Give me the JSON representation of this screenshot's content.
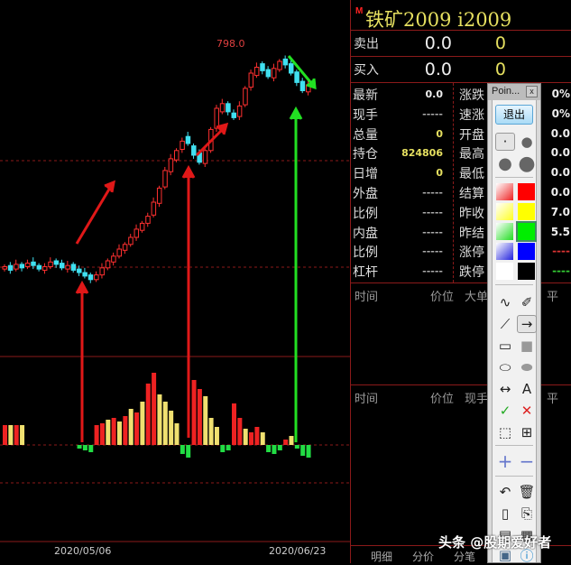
{
  "chart_data": {
    "type": "candlestick",
    "annotations": {
      "high_label": "798.0"
    },
    "x_labels": [
      "2020/05/06",
      "2020/06/23"
    ],
    "candles": {
      "close": [
        613,
        610,
        615,
        612,
        616,
        614,
        611,
        613,
        617,
        615,
        612,
        614,
        610,
        608,
        605,
        602,
        606,
        612,
        618,
        622,
        628,
        632,
        638,
        645,
        650,
        656,
        668,
        680,
        695,
        705,
        712,
        720,
        718,
        708,
        702,
        712,
        730,
        748,
        752,
        745,
        740,
        750,
        765,
        778,
        783,
        780,
        775,
        782,
        788,
        785,
        778,
        770,
        763,
        768
      ],
      "open": [
        611,
        614,
        611,
        615,
        613,
        617,
        614,
        610,
        613,
        618,
        616,
        611,
        615,
        611,
        608,
        606,
        602,
        606,
        612,
        617,
        622,
        627,
        632,
        638,
        644,
        650,
        657,
        667,
        681,
        694,
        704,
        713,
        724,
        716,
        710,
        701,
        712,
        731,
        745,
        752,
        744,
        741,
        751,
        766,
        776,
        786,
        781,
        774,
        781,
        790,
        786,
        779,
        771,
        762
      ]
    },
    "volume": [
      22,
      22,
      22,
      22,
      0,
      0,
      0,
      0,
      0,
      0,
      0,
      0,
      0,
      -4,
      -6,
      -8,
      22,
      24,
      28,
      30,
      26,
      32,
      40,
      36,
      48,
      68,
      80,
      56,
      48,
      38,
      24,
      -10,
      -14,
      72,
      62,
      54,
      30,
      20,
      -8,
      -6,
      46,
      30,
      18,
      14,
      20,
      14,
      -8,
      -10,
      -6,
      6,
      10,
      -4,
      -12,
      -14
    ],
    "volume_colors": [
      "r",
      "y",
      "r",
      "y",
      "y",
      "y",
      "y",
      "y",
      "y",
      "y",
      "y",
      "y",
      "y",
      "g",
      "g",
      "g",
      "r",
      "r",
      "y",
      "r",
      "y",
      "r",
      "y",
      "r",
      "y",
      "r",
      "r",
      "y",
      "y",
      "y",
      "y",
      "g",
      "g",
      "r",
      "r",
      "y",
      "y",
      "y",
      "g",
      "g",
      "r",
      "r",
      "y",
      "r",
      "r",
      "y",
      "g",
      "g",
      "g",
      "r",
      "y",
      "g",
      "g",
      "g"
    ]
  },
  "panel": {
    "marker": "M",
    "title": "铁矿2009  i2009",
    "sell": {
      "label": "卖出",
      "price": "0.0",
      "vol": "0"
    },
    "buy": {
      "label": "买入",
      "price": "0.0",
      "vol": "0"
    },
    "left": [
      {
        "l": "最新",
        "v": "0.0",
        "c": "#eee"
      },
      {
        "l": "现手",
        "v": "-----",
        "c": "#aaa"
      },
      {
        "l": "总量",
        "v": "0",
        "c": "#e6e060"
      },
      {
        "l": "持仓",
        "v": "824806",
        "c": "#e6e060"
      },
      {
        "l": "日增",
        "v": "0",
        "c": "#e6e060"
      },
      {
        "l": "外盘",
        "v": "-----",
        "c": "#aaa"
      },
      {
        "l": "比例",
        "v": "-----",
        "c": "#aaa"
      },
      {
        "l": "内盘",
        "v": "-----",
        "c": "#aaa"
      },
      {
        "l": "比例",
        "v": "-----",
        "c": "#aaa"
      },
      {
        "l": "杠杆",
        "v": "-----",
        "c": "#aaa"
      }
    ],
    "right": [
      {
        "l": "涨跌",
        "v": "0%"
      },
      {
        "l": "速涨",
        "v": "0%"
      },
      {
        "l": "开盘",
        "v": "0.0"
      },
      {
        "l": "最高",
        "v": "0.0"
      },
      {
        "l": "最低",
        "v": "0.0"
      },
      {
        "l": "结算",
        "v": "0.0"
      },
      {
        "l": "昨收",
        "v": "7.0"
      },
      {
        "l": "昨结",
        "v": "5.5"
      },
      {
        "l": "涨停",
        "v": "----"
      },
      {
        "l": "跌停",
        "v": "----"
      }
    ],
    "sec1": {
      "time": "时间",
      "price": "价位",
      "col3": "大单",
      "col4": "平"
    },
    "sec2": {
      "time": "时间",
      "price": "价位",
      "col3": "现手",
      "col4": "平"
    },
    "tabs": [
      "明细",
      "分价",
      "分笔"
    ]
  },
  "toolbar": {
    "title": "Poin...",
    "close": "x",
    "exit": "退出",
    "text_tool": "A"
  },
  "watermark": "头条 @股期爱好者"
}
